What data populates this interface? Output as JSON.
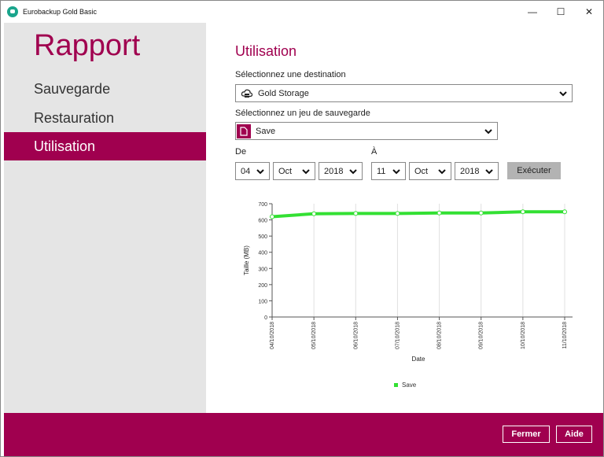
{
  "window": {
    "title": "Eurobackup Gold Basic",
    "minimize": "—",
    "maximize": "☐",
    "close": "✕"
  },
  "sidebar": {
    "title": "Rapport",
    "items": [
      {
        "label": "Sauvegarde"
      },
      {
        "label": "Restauration"
      },
      {
        "label": "Utilisation"
      }
    ]
  },
  "main": {
    "heading": "Utilisation",
    "destination_label": "Sélectionnez une destination",
    "destination_value": "Gold Storage",
    "backupset_label": "Sélectionnez un jeu de sauvegarde",
    "backupset_value": "Save",
    "from_label": "De",
    "to_label": "À",
    "from": {
      "day": "04",
      "month": "Oct",
      "year": "2018"
    },
    "to": {
      "day": "11",
      "month": "Oct",
      "year": "2018"
    },
    "execute_label": "Exécuter"
  },
  "chart_data": {
    "type": "line",
    "x": [
      "04/10/2018",
      "05/10/2018",
      "06/10/2018",
      "07/10/2018",
      "08/10/2018",
      "09/10/2018",
      "10/10/2018",
      "11/10/2018"
    ],
    "series": [
      {
        "name": "Save",
        "values": [
          620,
          638,
          640,
          640,
          643,
          643,
          650,
          650
        ],
        "color": "#33e033"
      }
    ],
    "xlabel": "Date",
    "ylabel": "Taille (MB)",
    "ylim": [
      0,
      700
    ],
    "yticks": [
      0,
      100,
      200,
      300,
      400,
      500,
      600,
      700
    ],
    "grid": "vertical",
    "legend": "bottom-center"
  },
  "footer": {
    "close_label": "Fermer",
    "help_label": "Aide"
  },
  "colors": {
    "accent": "#a0004f",
    "sidebar_bg": "#e5e5e5",
    "line": "#33e033"
  }
}
